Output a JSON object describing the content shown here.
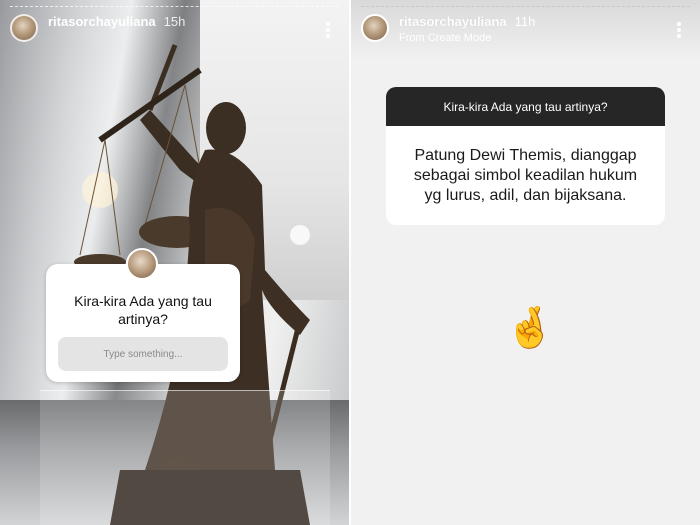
{
  "left_story": {
    "username": "ritasorchayuliana",
    "time": "15h",
    "question": {
      "text": "Kira-kira Ada yang tau artinya?",
      "input_placeholder": "Type something..."
    }
  },
  "right_story": {
    "username": "ritasorchayuliana",
    "time": "11h",
    "subtitle": "From Create Mode",
    "answer_card": {
      "question": "Kira-kira Ada yang tau artinya?",
      "answer": "Patung Dewi Themis, dianggap sebagai simbol keadilan hukum yg lurus, adil, dan bijaksana."
    },
    "emoji": "🤞"
  },
  "icons": {
    "more": "more-vertical-icon",
    "emoji": "crossed-fingers-icon"
  },
  "colors": {
    "card_header_bg": "#262626",
    "card_body_bg": "#ffffff",
    "right_bg": "#f1f1f1",
    "input_bg": "#e4e4e4"
  }
}
